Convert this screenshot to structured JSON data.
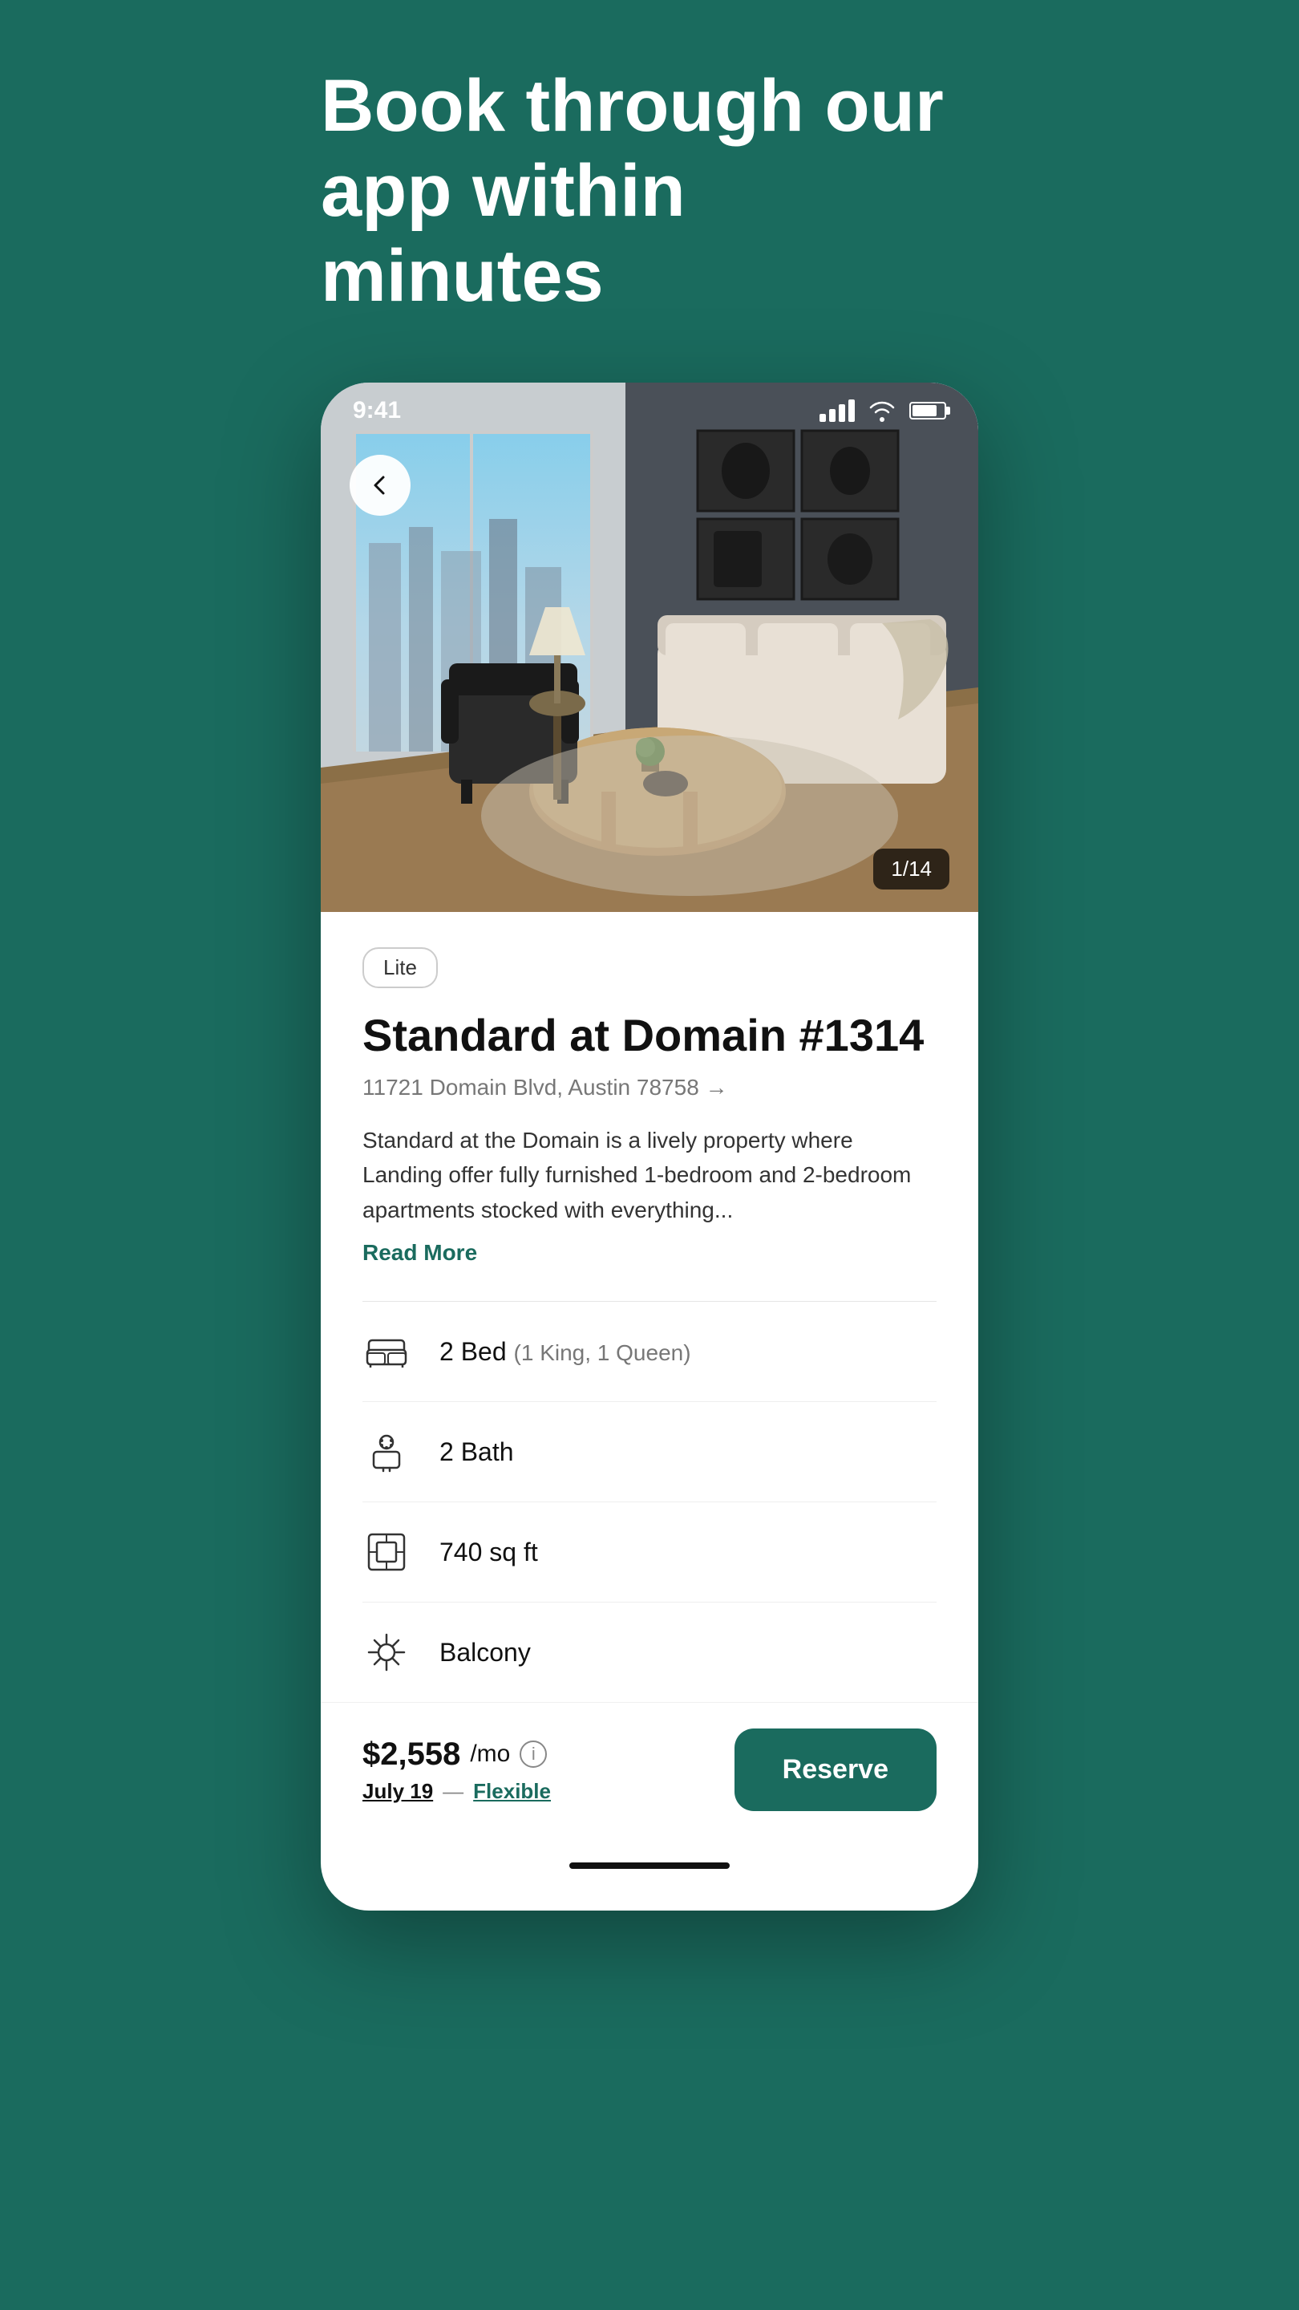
{
  "page": {
    "headline_line1": "Book through our",
    "headline_line2": "app within minutes"
  },
  "status_bar": {
    "time": "9:41"
  },
  "image": {
    "counter": "1/14"
  },
  "listing": {
    "badge": "Lite",
    "title": "Standard at Domain #1314",
    "address": "11721 Domain Blvd, Austin 78758 →",
    "description": "Standard at the Domain is a lively property where Landing offer fully furnished 1-bedroom and 2-bedroom apartments stocked with everything...",
    "read_more": "Read More"
  },
  "amenities": [
    {
      "id": "bed",
      "label": "2 Bed",
      "sublabel": "(1 King, 1 Queen)",
      "icon": "bed"
    },
    {
      "id": "bath",
      "label": "2 Bath",
      "sublabel": "",
      "icon": "bath"
    },
    {
      "id": "sqft",
      "label": "740 sq ft",
      "sublabel": "",
      "icon": "sqft"
    },
    {
      "id": "balcony",
      "label": "Balcony",
      "sublabel": "",
      "icon": "balcony"
    }
  ],
  "pricing": {
    "amount": "$2,558",
    "period": "/mo",
    "date": "July 19",
    "flexible": "Flexible",
    "reserve_btn": "Reserve"
  }
}
